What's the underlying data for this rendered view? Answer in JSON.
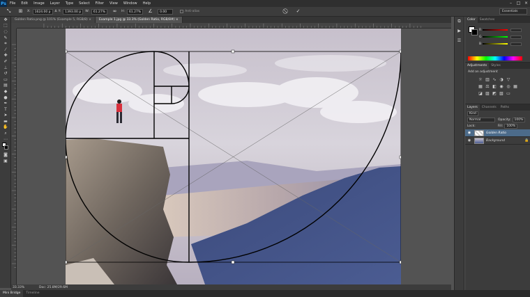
{
  "app": {
    "logo": "Ps"
  },
  "menu": [
    "File",
    "Edit",
    "Image",
    "Layer",
    "Type",
    "Select",
    "Filter",
    "View",
    "Window",
    "Help"
  ],
  "window_controls": [
    "–",
    "□",
    "×"
  ],
  "options": {
    "x_value": "1624.00 p",
    "y_value": "1393.00 p",
    "w_value": "61.27%",
    "h_value": "61.27%",
    "angle_value": "0.00",
    "antialias_label": "Anti-alias",
    "workspace": "Essentials",
    "icons": {
      "cancel": "⃠",
      "commit": "✓"
    }
  },
  "tabs": [
    {
      "label": "Golden Ratio.png @ 101% (Example 5, RGB/8) ×",
      "active": false
    },
    {
      "label": "Example 1.jpg @ 33.3% (Golden Ratio, RGB/8#) ×",
      "active": true
    }
  ],
  "status": {
    "zoom": "33.33%",
    "doc": "Doc: 25.8M/29.6M"
  },
  "bottom_tabs": [
    {
      "label": "Mini Bridge",
      "active": true
    },
    {
      "label": "Timeline",
      "active": false
    }
  ],
  "panels": {
    "color_tabs": [
      "Color",
      "Swatches"
    ],
    "adjust_tabs": [
      "Adjustments",
      "Styles"
    ],
    "adjust_title": "Add an adjustment",
    "layers_tabs": [
      "Layers",
      "Channels",
      "Paths"
    ],
    "kind_label": "Kind",
    "blend_mode": "Normal",
    "opacity_label": "Opacity:",
    "opacity_value": "100%",
    "lock_label": "Lock:",
    "fill_label": "Fill:",
    "fill_value": "100%",
    "layers": [
      {
        "name": "Golden Ratio",
        "selected": true
      },
      {
        "name": "Background",
        "selected": false
      }
    ]
  },
  "colors": {
    "menubar": "#2f2f2f",
    "panel": "#3c3c3c",
    "canvas": "#535353",
    "selected_layer": "#4c6b8a",
    "overlay_line": "#000000"
  }
}
